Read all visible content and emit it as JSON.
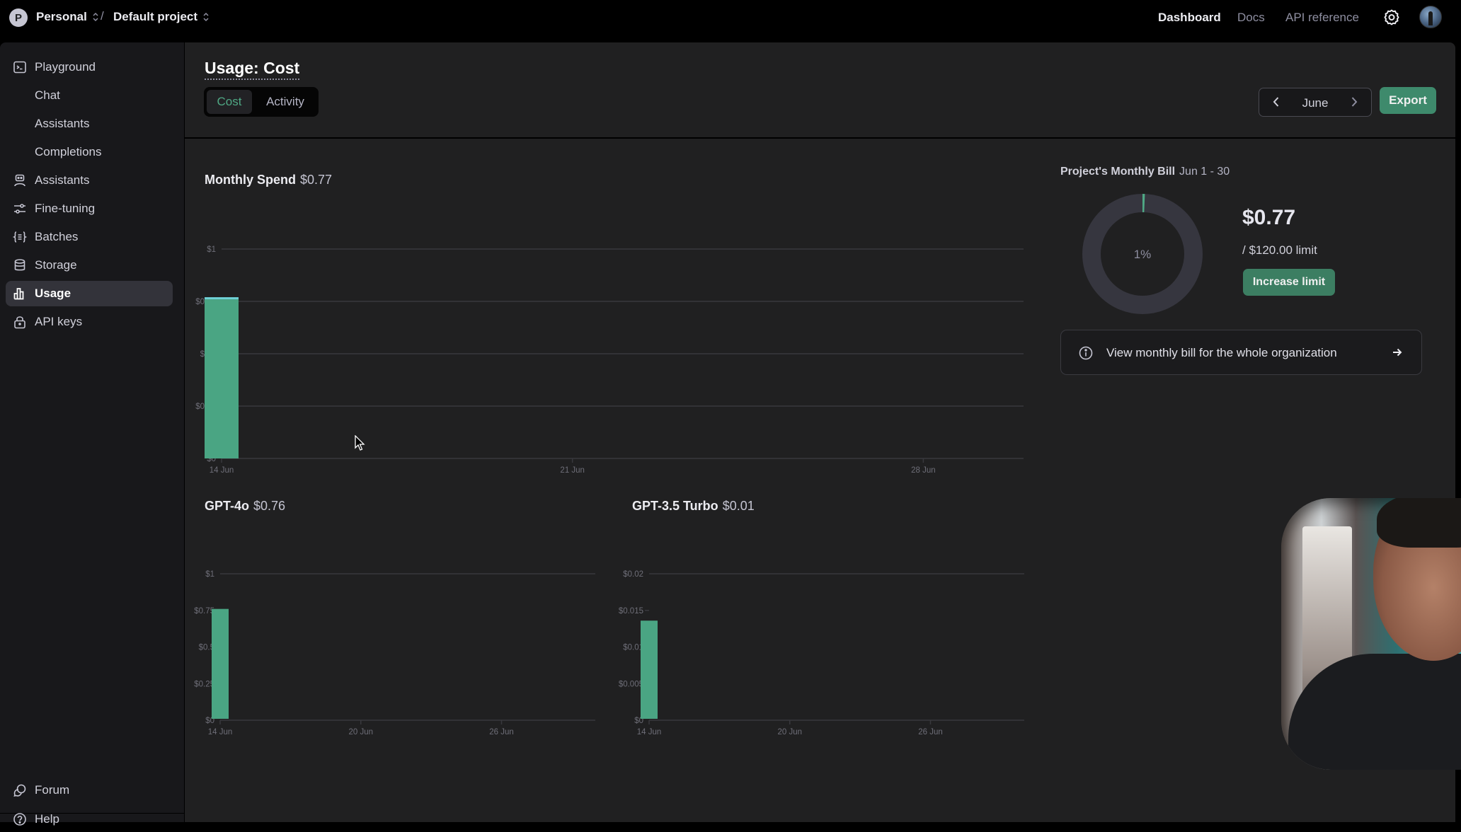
{
  "topbar": {
    "org_initial": "P",
    "org_name": "Personal",
    "separator": "/",
    "project_name": "Default project",
    "nav": [
      {
        "label": "Dashboard",
        "active": true
      },
      {
        "label": "Docs",
        "active": false
      },
      {
        "label": "API reference",
        "active": false
      }
    ],
    "settings_icon": "gear-icon",
    "avatar_icon": "user-avatar"
  },
  "sidebar": {
    "items": [
      {
        "label": "Playground",
        "icon": "terminal-icon"
      },
      {
        "label": "Chat",
        "icon": null
      },
      {
        "label": "Assistants",
        "icon": null
      },
      {
        "label": "Completions",
        "icon": null
      },
      {
        "label": "Assistants",
        "icon": "robot-icon"
      },
      {
        "label": "Fine-tuning",
        "icon": "sliders-icon"
      },
      {
        "label": "Batches",
        "icon": "braces-icon"
      },
      {
        "label": "Storage",
        "icon": "database-icon"
      },
      {
        "label": "Usage",
        "icon": "bar-chart-icon",
        "active": true
      },
      {
        "label": "API keys",
        "icon": "lock-icon"
      }
    ],
    "bottom": [
      {
        "label": "Forum",
        "icon": "chat-bubbles-icon"
      },
      {
        "label": "Help",
        "icon": "question-circle-icon"
      }
    ]
  },
  "main": {
    "title": "Usage: Cost",
    "tabs": [
      {
        "label": "Cost",
        "active": true
      },
      {
        "label": "Activity",
        "active": false
      }
    ],
    "month": "June",
    "export_label": "Export"
  },
  "bill": {
    "title": "Project's Monthly Bill",
    "range": "Jun 1 - 30",
    "percent_label": "1%",
    "used_fraction": 0.0064,
    "amount": "$0.77",
    "limit_text": "/ $120.00 limit",
    "increase_label": "Increase limit",
    "org_link_text": "View monthly bill for the whole organization"
  },
  "colors": {
    "accent": "#4fa884",
    "bar": "#4aa583",
    "bar_top": "#6fd0d6",
    "donut_track": "#36363f",
    "button": "#3e8a6c"
  },
  "chart_data": [
    {
      "type": "bar",
      "title": "Monthly Spend",
      "total": "$0.77",
      "xlabel": "",
      "ylabel": "",
      "ylim": [
        0,
        1
      ],
      "yticks": [
        0,
        0.25,
        0.5,
        0.75,
        1
      ],
      "ytick_labels": [
        "$0",
        "$0.25",
        "$0.5",
        "$0.75",
        "$1"
      ],
      "x_range": [
        14,
        30
      ],
      "xticks": [
        14,
        21,
        28
      ],
      "xtick_labels": [
        "14 Jun",
        "21 Jun",
        "28 Jun"
      ],
      "categories": [
        "14 Jun"
      ],
      "series": [
        {
          "name": "GPT-4o",
          "values": [
            0.76
          ]
        },
        {
          "name": "GPT-3.5 Turbo",
          "values": [
            0.01
          ]
        }
      ],
      "grid": true
    },
    {
      "type": "bar",
      "title": "GPT-4o",
      "total": "$0.76",
      "xlabel": "",
      "ylabel": "",
      "ylim": [
        0,
        1
      ],
      "yticks": [
        0,
        0.25,
        0.5,
        0.75,
        1
      ],
      "ytick_labels": [
        "$0",
        "$0.25",
        "$0.5",
        "$0.75",
        "$1"
      ],
      "x_range": [
        14,
        30
      ],
      "xticks": [
        14,
        20,
        26
      ],
      "xtick_labels": [
        "14 Jun",
        "20 Jun",
        "26 Jun"
      ],
      "categories": [
        "14 Jun"
      ],
      "values": [
        0.76
      ],
      "grid": false
    },
    {
      "type": "bar",
      "title": "GPT-3.5 Turbo",
      "total": "$0.01",
      "xlabel": "",
      "ylabel": "",
      "ylim": [
        0,
        0.02
      ],
      "yticks": [
        0,
        0.005,
        0.01,
        0.015,
        0.02
      ],
      "ytick_labels": [
        "$0",
        "$0.005",
        "$0.01",
        "$0.015",
        "$0.02"
      ],
      "x_range": [
        14,
        30
      ],
      "xticks": [
        14,
        20,
        26
      ],
      "xtick_labels": [
        "14 Jun",
        "20 Jun",
        "26 Jun"
      ],
      "categories": [
        "14 Jun"
      ],
      "values": [
        0.0136
      ],
      "grid": false
    }
  ]
}
